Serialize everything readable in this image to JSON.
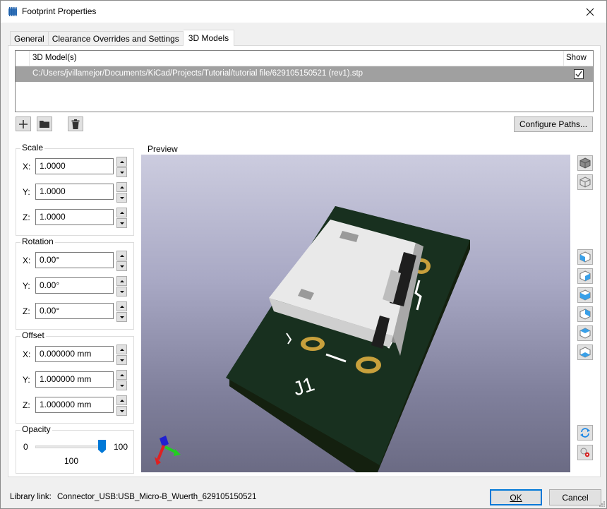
{
  "window": {
    "title": "Footprint Properties",
    "icon": "footprint-icon",
    "close_icon": "close-icon"
  },
  "tabs": [
    {
      "label": "General",
      "active": false
    },
    {
      "label": "Clearance Overrides and Settings",
      "active": false
    },
    {
      "label": "3D Models",
      "active": true
    }
  ],
  "models_grid": {
    "columns": {
      "model": "3D Model(s)",
      "show": "Show"
    },
    "rows": [
      {
        "path": "C:/Users/jvillamejor/Documents/KiCad/Projects/Tutorial/tutorial file/629105150521 (rev1).stp",
        "show": true,
        "selected": true
      }
    ]
  },
  "toolbar": {
    "add_icon": "plus-icon",
    "browse_icon": "folder-icon",
    "delete_icon": "trash-icon",
    "configure_paths_label": "Configure Paths..."
  },
  "scale": {
    "label": "Scale",
    "x": {
      "axis": "X:",
      "value": "1.0000"
    },
    "y": {
      "axis": "Y:",
      "value": "1.0000"
    },
    "z": {
      "axis": "Z:",
      "value": "1.0000"
    }
  },
  "rotation": {
    "label": "Rotation",
    "x": {
      "axis": "X:",
      "value": "0.00°"
    },
    "y": {
      "axis": "Y:",
      "value": "0.00°"
    },
    "z": {
      "axis": "Z:",
      "value": "0.00°"
    }
  },
  "offset": {
    "label": "Offset",
    "x": {
      "axis": "X:",
      "value": "0.000000 mm"
    },
    "y": {
      "axis": "Y:",
      "value": "1.000000 mm"
    },
    "z": {
      "axis": "Z:",
      "value": "1.000000 mm"
    }
  },
  "opacity": {
    "label": "Opacity",
    "min": "0",
    "max": "100",
    "value": "100",
    "fraction": 1.0
  },
  "preview": {
    "label": "Preview",
    "reference_designator": "J1",
    "colors": {
      "background_top": "#ccccdf",
      "background_bottom": "#6b6b84",
      "board": "#18301f",
      "pad": "#c8a03c",
      "silkscreen": "#ffffff",
      "connector_body": "#e6e6e6"
    }
  },
  "view_buttons": [
    "view-render-solid-icon",
    "view-render-wireframe-icon",
    "view-front-icon",
    "view-back-icon",
    "view-left-icon",
    "view-right-icon",
    "view-top-icon",
    "view-bottom-icon",
    "reload-icon",
    "settings-icon"
  ],
  "footer": {
    "library_link_label": "Library link:",
    "library_link_value": "Connector_USB:USB_Micro-B_Wuerth_629105150521",
    "ok_label": "OK",
    "cancel_label": "Cancel"
  }
}
